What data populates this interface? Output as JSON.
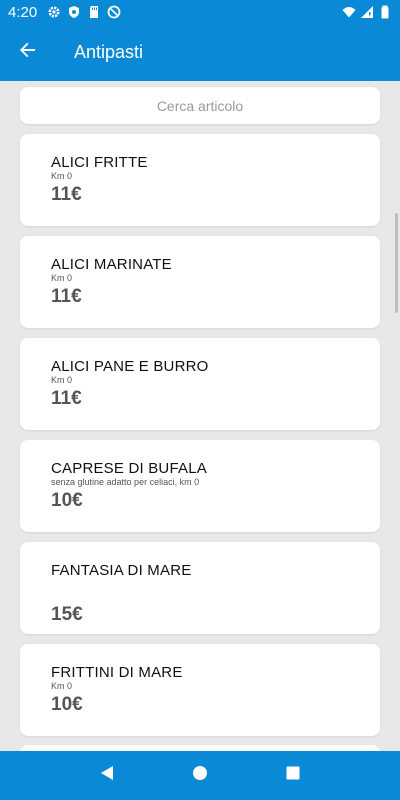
{
  "status": {
    "time": "4:20",
    "icons": [
      "gear-icon",
      "shield-icon",
      "sd-card-icon",
      "no-sync-icon",
      "wifi-icon",
      "signal-icon",
      "battery-icon"
    ]
  },
  "app_bar": {
    "title": "Antipasti",
    "back_icon": "arrow-back-icon"
  },
  "search": {
    "placeholder": "Cerca articolo"
  },
  "items": [
    {
      "name": "ALICI FRITTE",
      "desc": "Km 0",
      "price": "11€"
    },
    {
      "name": "ALICI MARINATE",
      "desc": "Km 0",
      "price": "11€"
    },
    {
      "name": "ALICI PANE E BURRO",
      "desc": "Km 0",
      "price": "11€"
    },
    {
      "name": "CAPRESE DI BUFALA",
      "desc": "senza glutine adatto per celiaci, km 0",
      "price": "10€"
    },
    {
      "name": "FANTASIA DI MARE",
      "desc": "",
      "price": "15€"
    },
    {
      "name": "FRITTINI DI MARE",
      "desc": "Km 0",
      "price": "10€"
    }
  ],
  "colors": {
    "primary": "#0a8ad6",
    "background": "#e8e8e8",
    "card": "#ffffff"
  },
  "nav": {
    "back_icon": "triangle-back-icon",
    "home_icon": "circle-home-icon",
    "recents_icon": "square-recents-icon"
  }
}
